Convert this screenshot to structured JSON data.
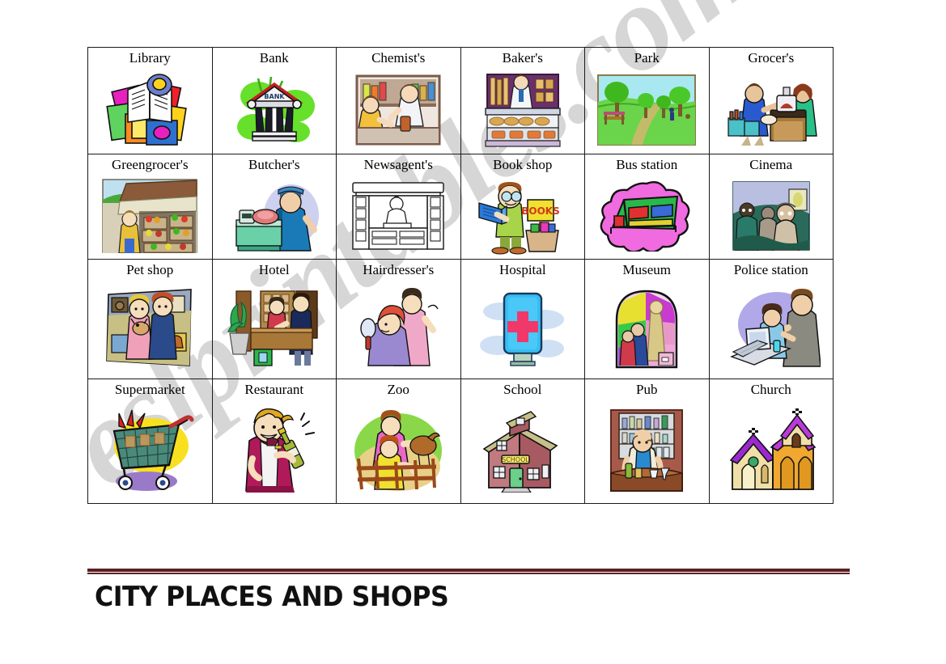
{
  "document": {
    "title": "CITY PLACES AND SHOPS",
    "watermark": "eslprintables.com",
    "rule_color": "#5a1f22",
    "page_background": "#ffffff",
    "border_color": "#1a1a1a"
  },
  "table": {
    "columns": 6,
    "rows": 4,
    "cells": [
      {
        "label": "Library",
        "icon": "books-stack-icon"
      },
      {
        "label": "Bank",
        "icon": "bank-building-icon"
      },
      {
        "label": "Chemist's",
        "icon": "pharmacist-counter-icon"
      },
      {
        "label": "Baker's",
        "icon": "bakery-display-icon"
      },
      {
        "label": "Park",
        "icon": "park-path-trees-icon"
      },
      {
        "label": "Grocer's",
        "icon": "grocer-scales-icon"
      },
      {
        "label": "Greengrocer's",
        "icon": "vegetable-stall-icon"
      },
      {
        "label": "Butcher's",
        "icon": "butcher-weighing-meat-icon"
      },
      {
        "label": "Newsagent's",
        "icon": "newsstand-kiosk-icon"
      },
      {
        "label": "Book shop",
        "icon": "boy-reading-book-icon"
      },
      {
        "label": "Bus station",
        "icon": "bus-shelter-icon"
      },
      {
        "label": "Cinema",
        "icon": "cinema-audience-icon"
      },
      {
        "label": "Pet shop",
        "icon": "pet-shop-couple-icon"
      },
      {
        "label": "Hotel",
        "icon": "hotel-reception-icon"
      },
      {
        "label": "Hairdresser's",
        "icon": "hairdresser-mirror-icon"
      },
      {
        "label": "Hospital",
        "icon": "hospital-cross-sign-icon"
      },
      {
        "label": "Museum",
        "icon": "museum-archway-exhibit-icon"
      },
      {
        "label": "Police station",
        "icon": "police-desk-officer-icon"
      },
      {
        "label": "Supermarket",
        "icon": "shopping-trolley-icon"
      },
      {
        "label": "Restaurant",
        "icon": "waiter-wine-bottle-icon"
      },
      {
        "label": "Zoo",
        "icon": "zoo-family-fence-icon"
      },
      {
        "label": "School",
        "icon": "school-building-icon"
      },
      {
        "label": "Pub",
        "icon": "barman-bar-icon"
      },
      {
        "label": "Church",
        "icon": "church-building-icon"
      }
    ]
  }
}
